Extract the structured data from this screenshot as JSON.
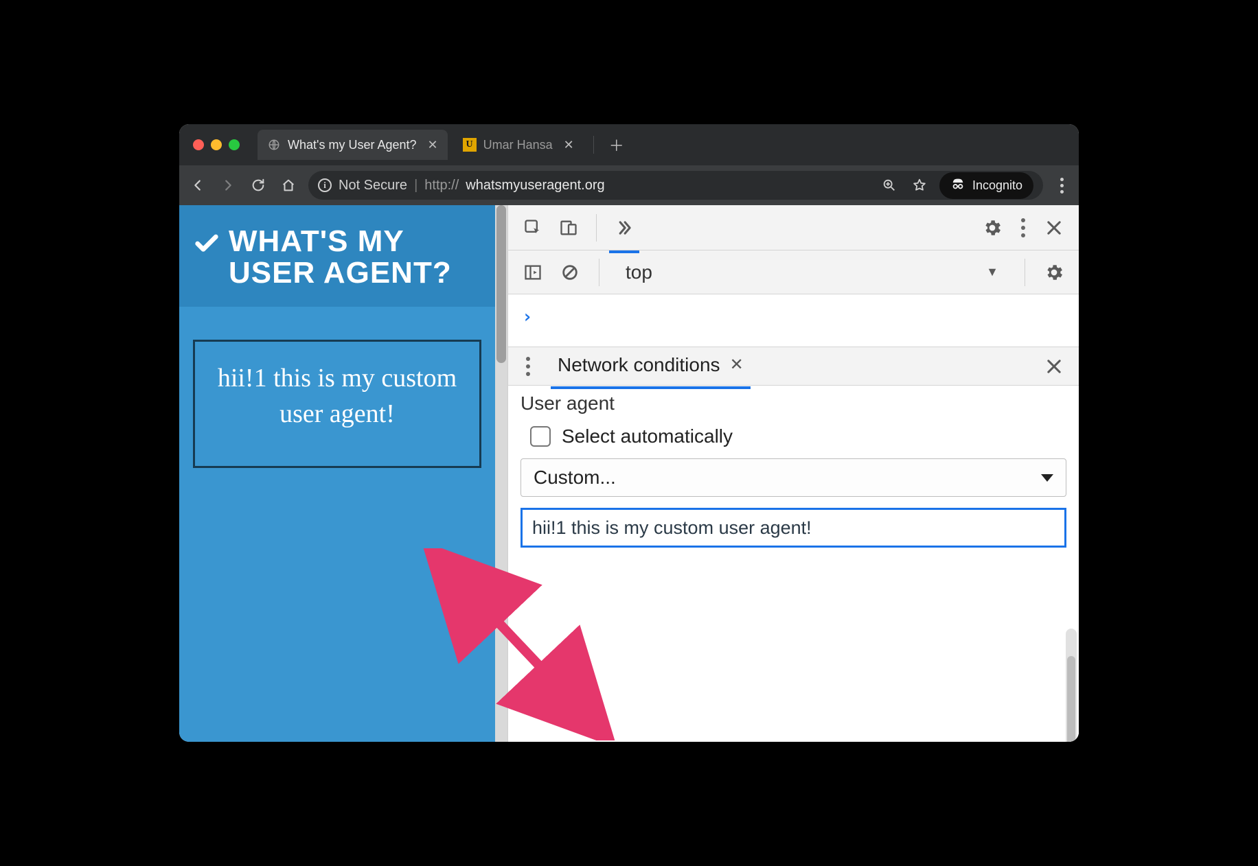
{
  "tabs": [
    {
      "title": "What's my User Agent?",
      "active": true
    },
    {
      "title": "Umar Hansa",
      "active": false
    }
  ],
  "addressBar": {
    "securityLabel": "Not Secure",
    "urlProtocol": "http://",
    "urlHost": "whatsmyuseragent.org",
    "incognitoLabel": "Incognito"
  },
  "page": {
    "heading": "WHAT'S MY USER AGENT?",
    "userAgentDisplay": "hii!1 this is my custom user agent!"
  },
  "devtools": {
    "contextSelector": "top",
    "drawer": {
      "tabLabel": "Network conditions",
      "userAgentSection": {
        "label": "User agent",
        "checkboxLabel": "Select automatically",
        "presetSelectValue": "Custom...",
        "customInputValue": "hii!1 this is my custom user agent!"
      }
    }
  }
}
